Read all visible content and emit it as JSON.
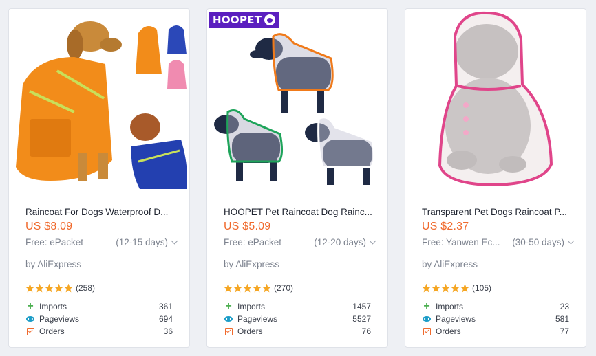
{
  "products": [
    {
      "title": "Raincoat For Dogs Waterproof D...",
      "price": "US $8.09",
      "shipping": "Free: ePacket",
      "days": "(12-15 days)",
      "seller": "by AliExpress",
      "rating_stars": 5,
      "reviews": "(258)",
      "stats": [
        {
          "label": "Imports",
          "value": "361",
          "icon": "plus-icon"
        },
        {
          "label": "Pageviews",
          "value": "694",
          "icon": "eye-icon"
        },
        {
          "label": "Orders",
          "value": "36",
          "icon": "order-box-icon"
        }
      ]
    },
    {
      "brand": "HOOPET",
      "title": "HOOPET Pet Raincoat Dog Rainc...",
      "price": "US $5.09",
      "shipping": "Free: ePacket",
      "days": "(12-20 days)",
      "seller": "by AliExpress",
      "rating_stars": 5,
      "reviews": "(270)",
      "stats": [
        {
          "label": "Imports",
          "value": "1457",
          "icon": "plus-icon"
        },
        {
          "label": "Pageviews",
          "value": "5527",
          "icon": "eye-icon"
        },
        {
          "label": "Orders",
          "value": "76",
          "icon": "order-box-icon"
        }
      ]
    },
    {
      "title": "Transparent Pet Dogs Raincoat P...",
      "price": "US $2.37",
      "shipping": "Free: Yanwen Ec...",
      "days": "(30-50 days)",
      "seller": "by AliExpress",
      "rating_stars": 5,
      "reviews": "(105)",
      "stats": [
        {
          "label": "Imports",
          "value": "23",
          "icon": "plus-icon"
        },
        {
          "label": "Pageviews",
          "value": "581",
          "icon": "eye-icon"
        },
        {
          "label": "Orders",
          "value": "77",
          "icon": "order-box-icon"
        }
      ]
    }
  ],
  "colors": {
    "price": "#f06a2d",
    "star": "#f5a623",
    "imports_icon": "#4caf50",
    "pageviews_icon": "#1a9cc7",
    "orders_icon": "#f06a2d",
    "brand_badge": "#5b1fbf"
  }
}
